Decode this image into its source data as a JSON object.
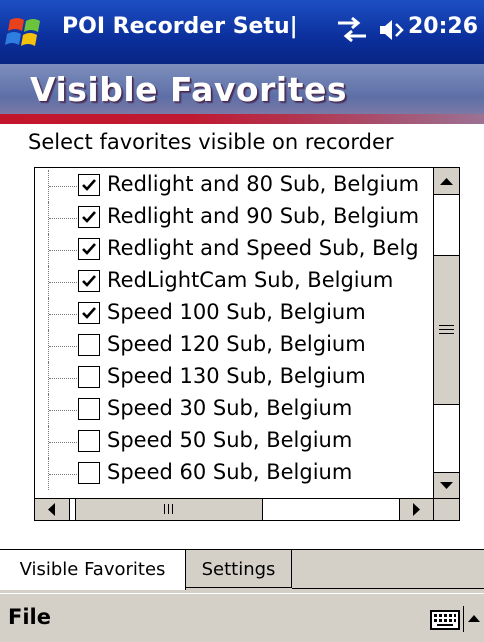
{
  "titlebar": {
    "app_title": "POI Recorder Setu|",
    "time": "20:26"
  },
  "header": {
    "title": "Visible Favorites"
  },
  "instruction": "Select favorites visible on recorder",
  "favorites": [
    {
      "label": "Redlight and 80 Sub, Belgium",
      "checked": true
    },
    {
      "label": "Redlight and 90 Sub, Belgium",
      "checked": true
    },
    {
      "label": "Redlight and Speed Sub, Belg",
      "checked": true
    },
    {
      "label": "RedLightCam Sub, Belgium",
      "checked": true
    },
    {
      "label": "Speed 100 Sub, Belgium",
      "checked": true
    },
    {
      "label": "Speed 120 Sub, Belgium",
      "checked": false
    },
    {
      "label": "Speed 130 Sub, Belgium",
      "checked": false
    },
    {
      "label": "Speed 30 Sub, Belgium",
      "checked": false
    },
    {
      "label": "Speed 50 Sub, Belgium",
      "checked": false
    },
    {
      "label": "Speed 60 Sub, Belgium",
      "checked": false
    }
  ],
  "tabs": [
    {
      "label": "Visible Favorites",
      "active": true
    },
    {
      "label": "Settings",
      "active": false
    }
  ],
  "menu": {
    "file_label": "File"
  },
  "icons": {
    "start": "windows-flag-icon",
    "connectivity": "connectivity-arrows-icon",
    "volume": "speaker-icon",
    "keyboard": "keyboard-icon"
  },
  "colors": {
    "titlebar": "#0b2f9c",
    "banner_stripe": "#c2162c",
    "chrome": "#d4d0c8"
  }
}
